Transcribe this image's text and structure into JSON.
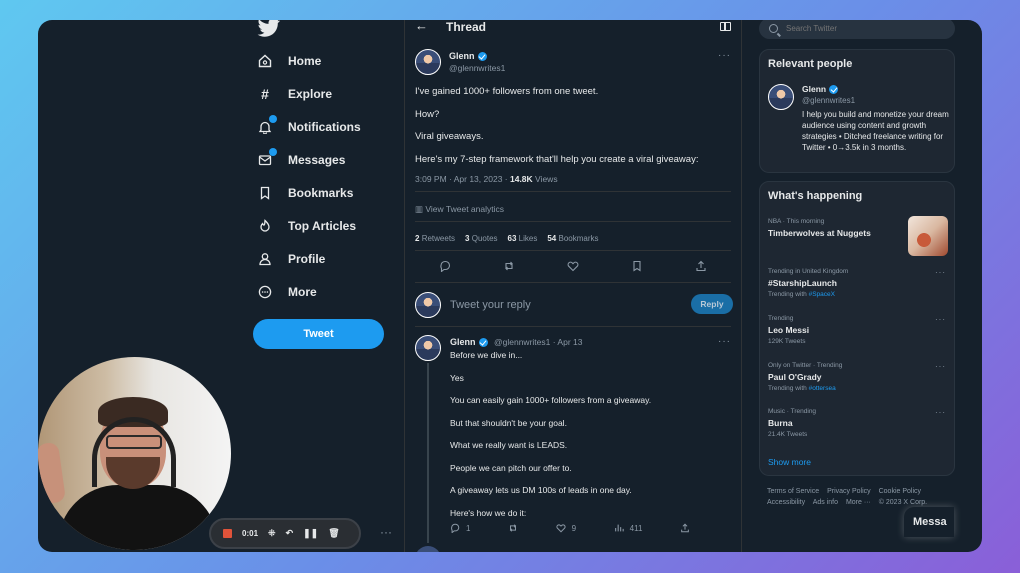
{
  "nav": {
    "items": [
      {
        "label": "Home",
        "icon": "home-icon"
      },
      {
        "label": "Explore",
        "icon": "hashtag-icon"
      },
      {
        "label": "Notifications",
        "icon": "bell-icon"
      },
      {
        "label": "Messages",
        "icon": "envelope-icon"
      },
      {
        "label": "Bookmarks",
        "icon": "bookmark-icon"
      },
      {
        "label": "Top Articles",
        "icon": "flame-icon"
      },
      {
        "label": "Profile",
        "icon": "person-icon"
      },
      {
        "label": "More",
        "icon": "more-circle-icon"
      }
    ],
    "tweet_button": "Tweet",
    "more_dots": "···"
  },
  "thread": {
    "title": "Thread",
    "back_glyph": "←",
    "author_name": "Glenn",
    "author_handle": "@glennwrites1",
    "dots": "···",
    "lines": [
      "I've gained 1000+ followers from one tweet.",
      "How?",
      "Viral giveaways.",
      "Here's my 7-step framework that'll help you create a viral giveaway:"
    ],
    "timestamp": "3:09 PM · Apr 13, 2023 ·",
    "views_count": "14.8K",
    "views_label": "Views",
    "analytics": "View Tweet analytics",
    "stats": {
      "retweets": "2",
      "retweets_label": "Retweets",
      "quotes": "3",
      "quotes_label": "Quotes",
      "likes": "63",
      "likes_label": "Likes",
      "bookmarks": "54",
      "bookmarks_label": "Bookmarks"
    },
    "reply_placeholder": "Tweet your reply",
    "reply_button": "Reply"
  },
  "reply_tweet": {
    "name": "Glenn",
    "handle_date": "@glennwrites1 · Apr 13",
    "dots": "···",
    "lines": [
      "Before we dive in...",
      "Yes",
      "You can easily gain 1000+ followers from a giveaway.",
      "But that shouldn't be your goal.",
      "What we really want is LEADS.",
      "People we can pitch our offer to.",
      "A giveaway lets us DM 100s of leads in one day.",
      "Here's how we do it:"
    ],
    "replies": "1",
    "likes": "9",
    "views": "411"
  },
  "search": {
    "placeholder": "Search Twitter"
  },
  "relevant": {
    "title": "Relevant people",
    "name": "Glenn",
    "handle": "@glennwrites1",
    "bio": "I help you build and monetize your dream audience using content and growth strategies • Ditched freelance writing for Twitter • 0→3.5k in 3 months."
  },
  "happening": {
    "title": "What's happening",
    "trends": [
      {
        "context": "NBA · This morning",
        "title": "Timberwolves at Nuggets",
        "sub": "",
        "sub_link": ""
      },
      {
        "context": "Trending in United Kingdom",
        "title": "#StarshipLaunch",
        "sub": "Trending with",
        "sub_link": "#SpaceX"
      },
      {
        "context": "Trending",
        "title": "Leo Messi",
        "sub": "129K Tweets",
        "sub_link": ""
      },
      {
        "context": "Only on Twitter · Trending",
        "title": "Paul O'Grady",
        "sub": "Trending with",
        "sub_link": "#ottersea"
      },
      {
        "context": "Music · Trending",
        "title": "Burna",
        "sub": "21.4K Tweets",
        "sub_link": ""
      }
    ],
    "show_more": "Show more"
  },
  "footer": {
    "links": [
      "Terms of Service",
      "Privacy Policy",
      "Cookie Policy",
      "Accessibility",
      "Ads info",
      "More ···",
      "© 2023 X Corp."
    ]
  },
  "messages_drawer": "Messa",
  "recorder": {
    "time": "0:01"
  },
  "colors": {
    "accent": "#1d9bf0",
    "background": "#15202b",
    "record": "#e0533a"
  }
}
